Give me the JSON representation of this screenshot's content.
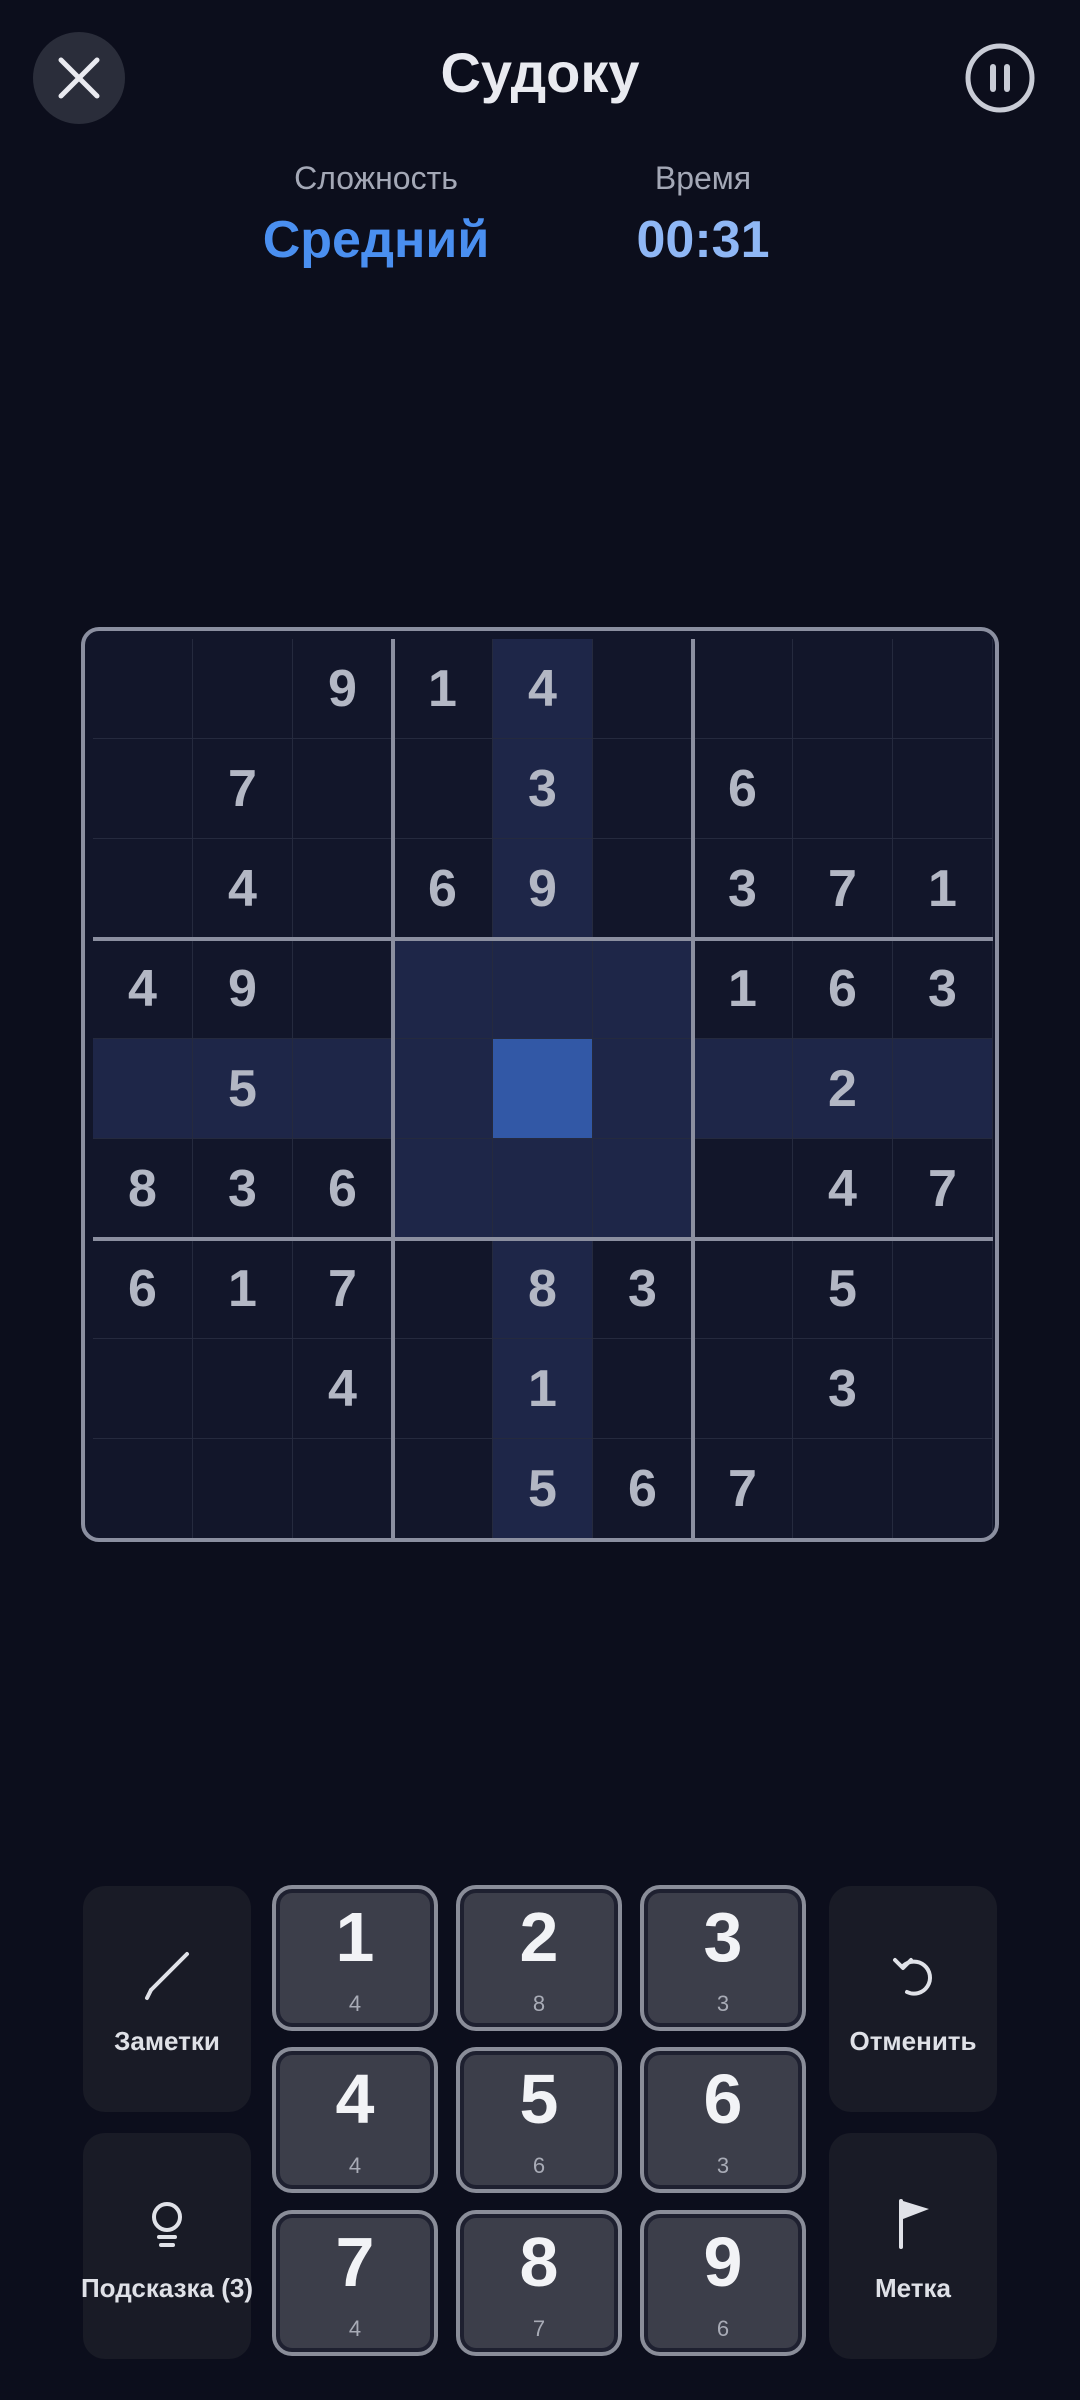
{
  "header": {
    "title": "Судоку",
    "close_icon": "close-icon",
    "pause_icon": "pause-icon"
  },
  "stats": {
    "difficulty_label": "Сложность",
    "difficulty_value": "Средний",
    "time_label": "Время",
    "time_value": "00:31"
  },
  "board": {
    "selected": [
      4,
      4
    ],
    "grid": [
      [
        "",
        "",
        "9",
        "1",
        "4",
        "",
        "",
        "",
        ""
      ],
      [
        "",
        "7",
        "",
        "",
        "3",
        "",
        "6",
        "",
        ""
      ],
      [
        "",
        "4",
        "",
        "6",
        "9",
        "",
        "3",
        "7",
        "1"
      ],
      [
        "4",
        "9",
        "",
        "",
        "",
        "",
        "1",
        "6",
        "3"
      ],
      [
        "",
        "5",
        "",
        "",
        "",
        "",
        "",
        "2",
        ""
      ],
      [
        "8",
        "3",
        "6",
        "",
        "",
        "",
        "",
        "4",
        "7"
      ],
      [
        "6",
        "1",
        "7",
        "",
        "8",
        "3",
        "",
        "5",
        ""
      ],
      [
        "",
        "",
        "4",
        "",
        "1",
        "",
        "",
        "3",
        ""
      ],
      [
        "",
        "",
        "",
        "",
        "5",
        "6",
        "7",
        "",
        ""
      ]
    ],
    "colors": {
      "highlight": "#1e2648",
      "selected": "#3258a6"
    }
  },
  "controls": {
    "notes_label": "Заметки",
    "notes_icon": "pencil-icon",
    "undo_label": "Отменить",
    "undo_icon": "undo-icon",
    "hint_label": "Подсказка (3)",
    "hint_icon": "lightbulb-icon",
    "flag_label": "Метка",
    "flag_icon": "flag-icon"
  },
  "numpad": [
    {
      "digit": "1",
      "count": "4"
    },
    {
      "digit": "2",
      "count": "8"
    },
    {
      "digit": "3",
      "count": "3"
    },
    {
      "digit": "4",
      "count": "4"
    },
    {
      "digit": "5",
      "count": "6"
    },
    {
      "digit": "6",
      "count": "3"
    },
    {
      "digit": "7",
      "count": "4"
    },
    {
      "digit": "8",
      "count": "7"
    },
    {
      "digit": "9",
      "count": "6"
    }
  ]
}
